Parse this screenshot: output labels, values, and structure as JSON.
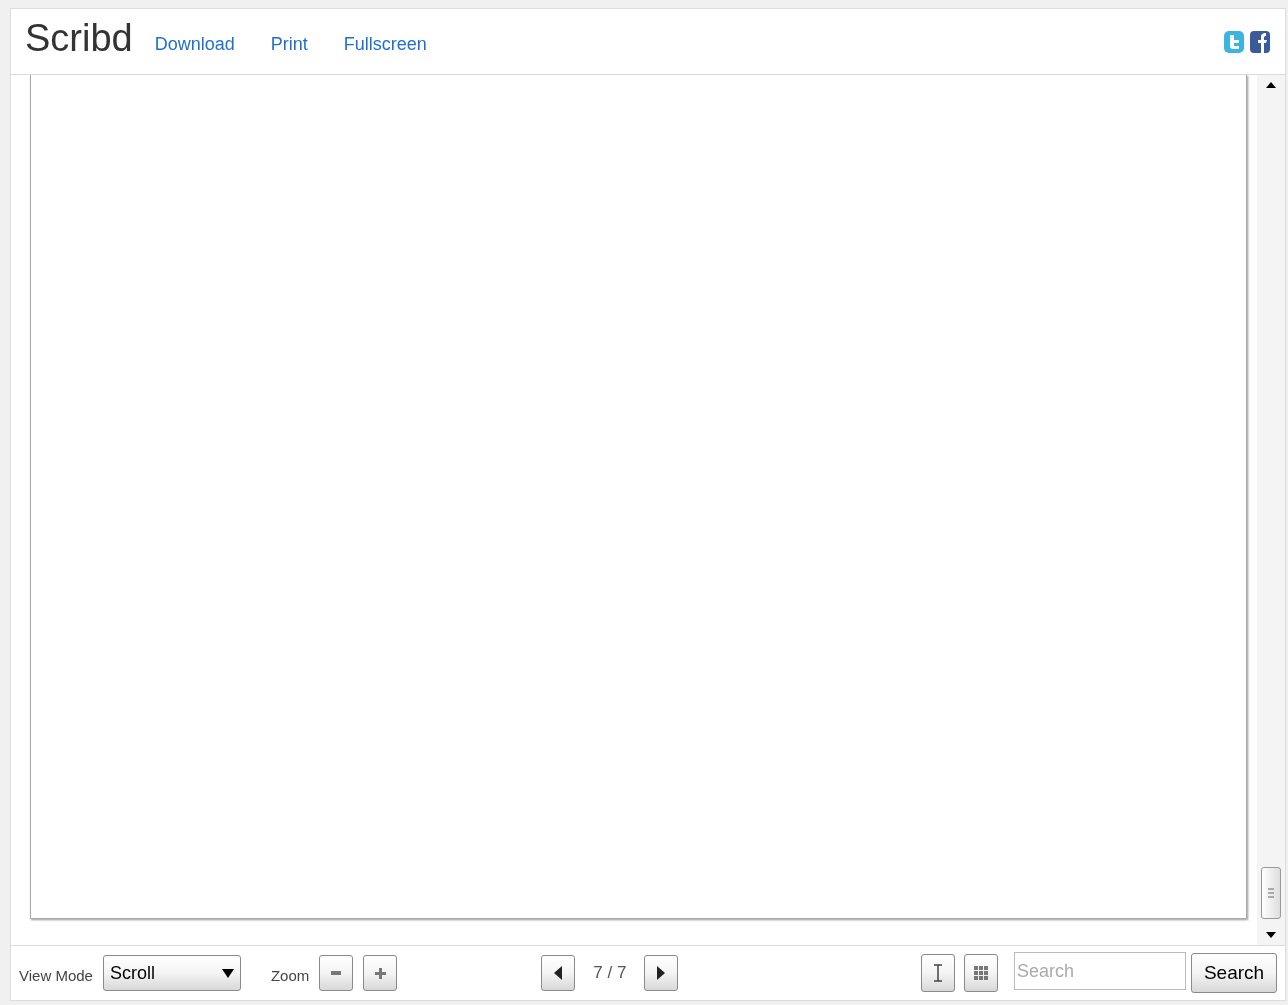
{
  "header": {
    "logo": "Scribd",
    "links": [
      "Download",
      "Print",
      "Fullscreen"
    ]
  },
  "toolbar": {
    "view_mode_label": "View Mode",
    "view_mode_value": "Scroll",
    "zoom_label": "Zoom",
    "page_indicator": "7 / 7",
    "search": {
      "placeholder": "Search"
    },
    "search_button": "Search"
  }
}
